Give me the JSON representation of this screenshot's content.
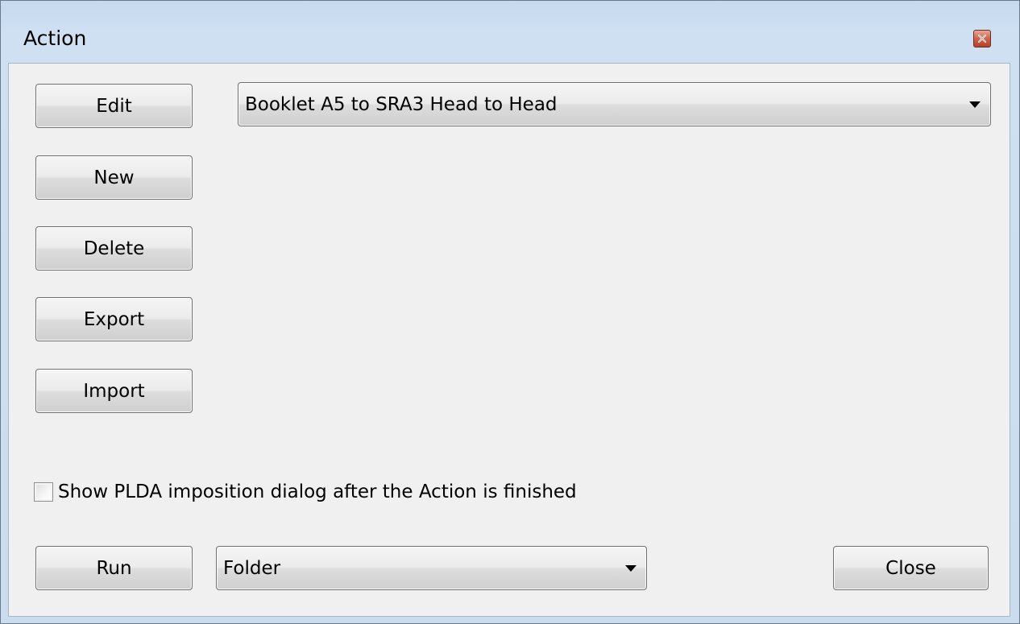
{
  "window": {
    "title": "Action",
    "close_icon": "close-icon"
  },
  "buttons": {
    "edit": "Edit",
    "new": "New",
    "delete": "Delete",
    "export": "Export",
    "import": "Import",
    "run": "Run",
    "close": "Close"
  },
  "action_select": {
    "value": "Booklet A5 to SRA3 Head to Head"
  },
  "checkbox": {
    "label": "Show PLDA imposition dialog after the Action is finished",
    "checked": false
  },
  "output_select": {
    "value": "Folder"
  },
  "colors": {
    "frame": "#cadced",
    "client": "#f0f0f0",
    "close_button": "#c8503a"
  }
}
